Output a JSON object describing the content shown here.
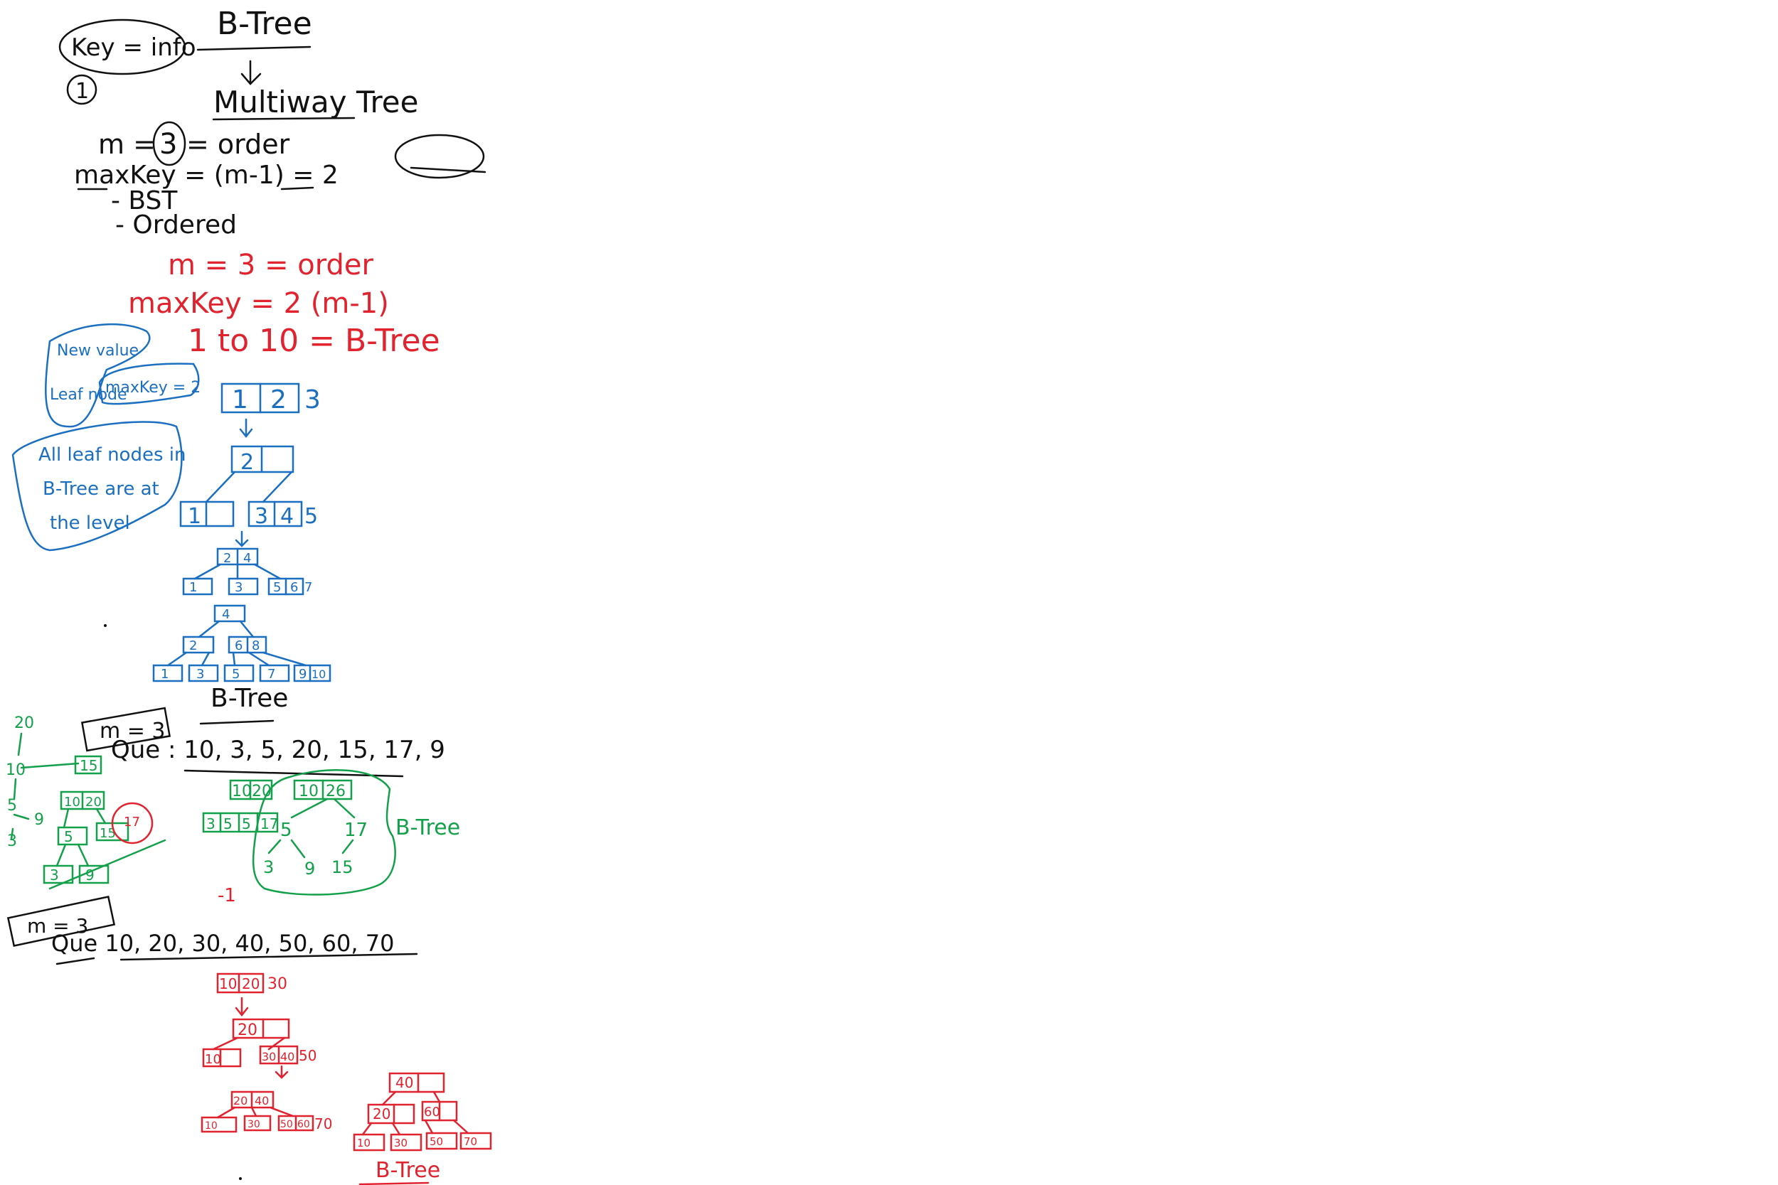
{
  "colors": {
    "black": "#111111",
    "red": "#e0232e",
    "blue": "#1b6fc0",
    "green": "#13a04a"
  },
  "header": {
    "key_info": "Key = info",
    "circle_num": "1",
    "btree_title": "B-Tree",
    "multiway": "Multiway Tree",
    "m_line_pre": "m =",
    "m_value": "3",
    "m_line_post": "= order",
    "maxkey_line": "maxKey = (m-1) = 2",
    "bst_line": "- BST",
    "ordered_line": "- Ordered"
  },
  "red_notes": {
    "m_order": "m = 3 = order",
    "maxkey": "maxKey = 2 (m-1)",
    "range": "1 to 10 = B-Tree"
  },
  "blue_notes": {
    "new_value": "New value",
    "leaf_node": "Leaf node",
    "max_key": "maxKey = 2",
    "all_leaf_1": "All leaf nodes in",
    "all_leaf_2": "B-Tree are at",
    "all_leaf_3": "the level"
  },
  "blue_tree": {
    "step1_keys": [
      "1",
      "2"
    ],
    "step1_extra": "3",
    "step2_root": "2",
    "step2_left": "1",
    "step2_right": [
      "3",
      "4"
    ],
    "step2_extra": "5",
    "step3_root": [
      "2",
      "4"
    ],
    "step3_leaves": [
      "1",
      "3",
      "5",
      "6"
    ],
    "step3_extra": "7",
    "step4_root": "4",
    "step4_mid": [
      "2",
      "6",
      "8"
    ],
    "step4_leaves": [
      "1",
      "3",
      "5",
      "7",
      "9",
      "10"
    ],
    "label": "B-Tree"
  },
  "question1": {
    "m_box": "m = 3",
    "sequence": "Que : 10, 3, 5, 20, 15, 17, 9",
    "left_keys": [
      "20",
      "10",
      "5",
      "9",
      "3",
      "15",
      "10",
      "20",
      "5",
      "15",
      "17",
      "3",
      "9"
    ],
    "tree_keys": [
      "10",
      "20",
      "10",
      "26",
      "3",
      "5",
      "5",
      "17",
      "5",
      "17",
      "3",
      "9",
      "15"
    ],
    "label": "B-Tree"
  },
  "minus_one": "-1",
  "question2": {
    "m_box": "m = 3",
    "sequence": "Que 10, 20, 30, 40, 50, 60, 70",
    "step1_keys": [
      "10",
      "20"
    ],
    "step1_extra": "30",
    "step2_root": "20",
    "step2_left": "10",
    "step2_right": [
      "30",
      "40"
    ],
    "step2_extra": "50",
    "step3_root": [
      "20",
      "40"
    ],
    "step3_leaves": [
      "10",
      "30",
      "50",
      "60"
    ],
    "step3_extra": "70",
    "final_root": "40",
    "final_mid": [
      "20",
      "60"
    ],
    "final_leaves": [
      "10",
      "30",
      "50",
      "70"
    ],
    "label": "B-Tree"
  }
}
